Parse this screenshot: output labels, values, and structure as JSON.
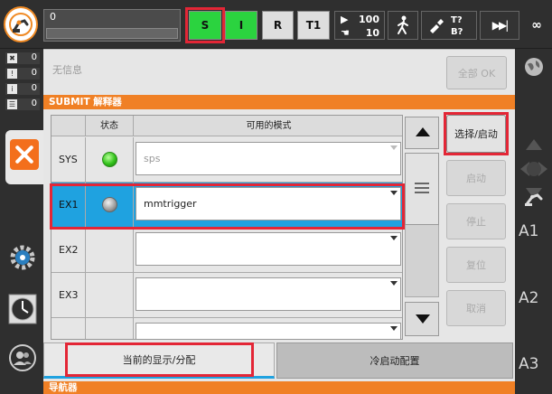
{
  "topbar": {
    "message_count": "0",
    "mode_buttons": [
      {
        "id": "s",
        "label": "S",
        "state": "active"
      },
      {
        "id": "i",
        "label": "I",
        "state": "active"
      },
      {
        "id": "r",
        "label": "R",
        "state": "inactive"
      },
      {
        "id": "t1",
        "label": "T1",
        "state": "inactive"
      }
    ],
    "override": {
      "program": "100",
      "jog": "10"
    },
    "tool_base": {
      "tool": "T?",
      "base": "B?"
    },
    "increment": "∞"
  },
  "left_counters": [
    {
      "icon": "error-icon",
      "value": "0"
    },
    {
      "icon": "warning-icon",
      "value": "0"
    },
    {
      "icon": "info-icon",
      "value": "0"
    },
    {
      "icon": "note-icon",
      "value": "0"
    }
  ],
  "messages": {
    "text": "无信息",
    "ack_all_label": "全部 OK"
  },
  "panel": {
    "title": "SUBMIT 解释器",
    "columns": [
      "",
      "状态",
      "可用的模式"
    ],
    "rows": [
      {
        "name": "SYS",
        "status": "green",
        "mode": "sps",
        "selected": false
      },
      {
        "name": "EX1",
        "status": "grey",
        "mode": "mmtrigger",
        "selected": true
      },
      {
        "name": "EX2",
        "status": "",
        "mode": "",
        "selected": false
      },
      {
        "name": "EX3",
        "status": "",
        "mode": "",
        "selected": false
      },
      {
        "name": "",
        "status": "",
        "mode": "",
        "selected": false
      }
    ],
    "buttons": {
      "select_start": "选择/启动",
      "start": "启动",
      "stop": "停止",
      "reset": "复位",
      "cancel": "取消"
    },
    "tabs": {
      "display": "当前的显示/分配",
      "cold_start": "冷启动配置"
    }
  },
  "navigator_title": "导航器",
  "right_axes": [
    "A1",
    "A2",
    "A3"
  ],
  "colors": {
    "accent_orange": "#f08025",
    "active_green": "#2bd33f",
    "selected_blue": "#1fa2e0",
    "highlight_red": "#e32636"
  }
}
